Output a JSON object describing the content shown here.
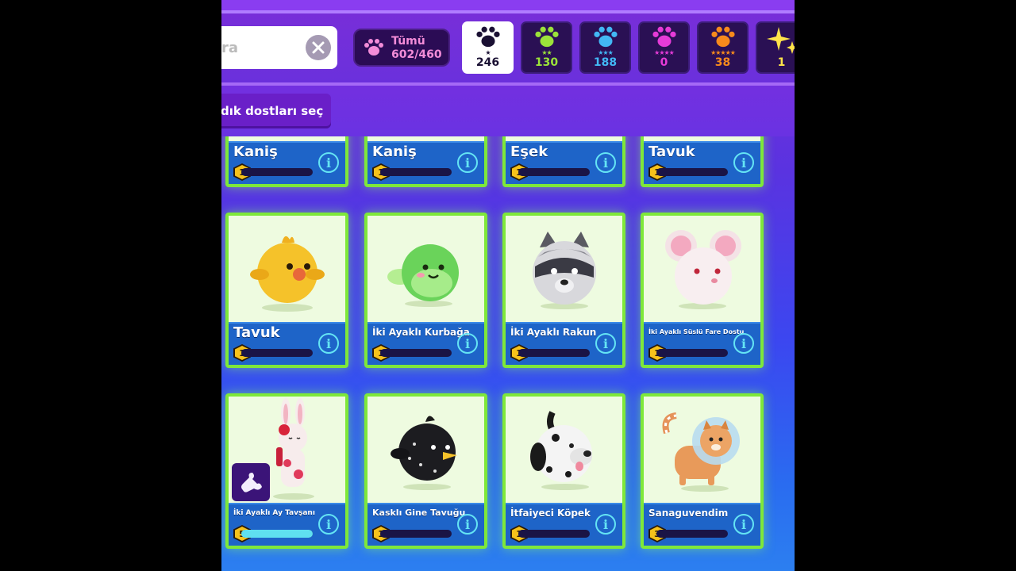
{
  "search": {
    "value": "ra"
  },
  "all_filter": {
    "label": "Tümü",
    "count": "602/460"
  },
  "filters": [
    {
      "stars": "★",
      "count": "246",
      "color": "#1a1033",
      "active": true
    },
    {
      "stars": "★★",
      "count": "130",
      "color": "#9be23a"
    },
    {
      "stars": "★★★",
      "count": "188",
      "color": "#42b8f5"
    },
    {
      "stars": "★★★★",
      "count": "0",
      "color": "#e63bd8"
    },
    {
      "stars": "★★★★★",
      "count": "38",
      "color": "#f78a1c"
    },
    {
      "stars": "",
      "count": "1",
      "color": "#ffe44a"
    }
  ],
  "select_button": {
    "label": "dık dostları seç"
  },
  "cards": [
    {
      "name": "Kaniş",
      "level": "1",
      "xp_fraction": 0
    },
    {
      "name": "Kaniş",
      "level": "1",
      "xp_fraction": 0
    },
    {
      "name": "Eşek",
      "level": "1",
      "xp_fraction": 0
    },
    {
      "name": "Tavuk",
      "level": "1",
      "xp_fraction": 0
    },
    {
      "name": "Tavuk",
      "level": "1",
      "xp_fraction": 0,
      "creature": "chick"
    },
    {
      "name": "İki Ayaklı Kurbağa",
      "level": "1",
      "xp_fraction": 0,
      "creature": "frog"
    },
    {
      "name": "İki Ayaklı Rakun",
      "level": "1",
      "xp_fraction": 0,
      "creature": "raccoon"
    },
    {
      "name": "İki Ayaklı Süslü Fare Dostu",
      "level": "1",
      "xp_fraction": 0,
      "creature": "mouse"
    },
    {
      "name": "İki Ayaklı Ay Tavşanı",
      "level": "5",
      "xp_fraction": 1,
      "creature": "rabbit"
    },
    {
      "name": "Kasklı Gine Tavuğu",
      "level": "1",
      "xp_fraction": 0,
      "creature": "guineafowl"
    },
    {
      "name": "İtfaiyeci Köpek",
      "level": "1",
      "xp_fraction": 0,
      "creature": "dalmatian"
    },
    {
      "name": "Sanaguvendim",
      "level": "3",
      "xp_fraction": 0,
      "creature": "fox"
    }
  ]
}
